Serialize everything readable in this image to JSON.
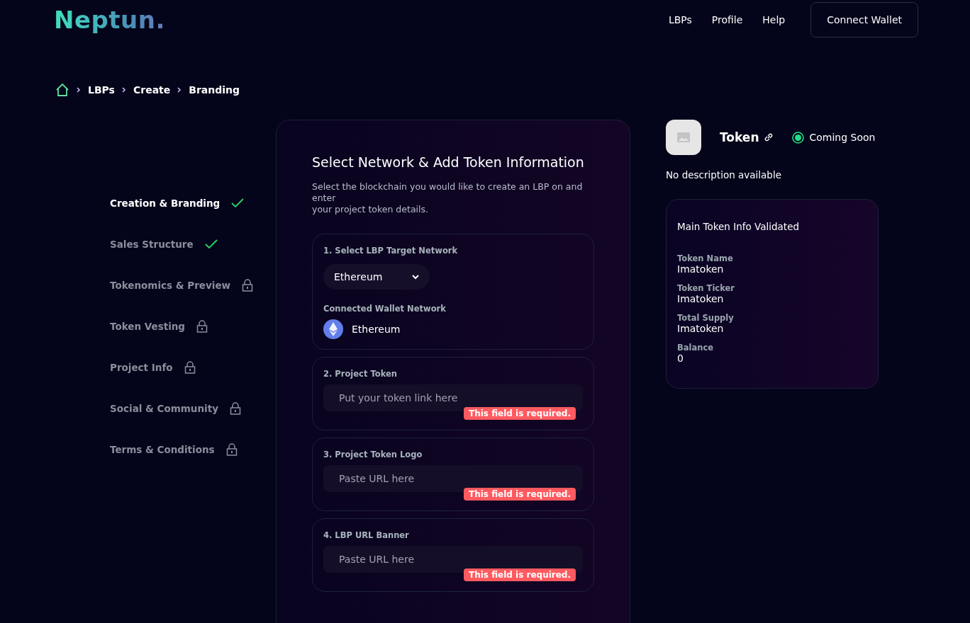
{
  "header": {
    "logo": "Neptun.",
    "nav": [
      "LBPs",
      "Profile",
      "Help"
    ],
    "connect_button": "Connect Wallet"
  },
  "breadcrumb": [
    "LBPs",
    "Create",
    "Branding"
  ],
  "steps": [
    {
      "label": "Creation & Branding",
      "selected": true,
      "kind": "done"
    },
    {
      "label": "Sales Structure",
      "selected": false,
      "kind": "done"
    },
    {
      "label": "Tokenomics & Preview",
      "selected": false,
      "kind": "locked"
    },
    {
      "label": "Token Vesting",
      "selected": false,
      "kind": "locked"
    },
    {
      "label": "Project Info",
      "selected": false,
      "kind": "locked"
    },
    {
      "label": "Social & Community",
      "selected": false,
      "kind": "locked"
    },
    {
      "label": "Terms & Conditions",
      "selected": false,
      "kind": "locked"
    }
  ],
  "form": {
    "title": "Select Network & Add Token Information",
    "description": "Select the blockchain you would like to create an LBP on and enter\nyour project token details.",
    "sections": [
      {
        "kind": "select",
        "label": "1. Select LBP Target Network",
        "value": "Ethereum",
        "wallet_label": "Connected Wallet Network",
        "wallet_network": "Ethereum"
      },
      {
        "kind": "input",
        "label": "2. Project Token",
        "placeholder": "Put your token link here",
        "error": "This field is required."
      },
      {
        "kind": "input",
        "label": "3. Project Token Logo",
        "placeholder": "Paste URL here",
        "error": "This field is required."
      },
      {
        "kind": "input",
        "label": "4. LBP URL Banner",
        "placeholder": "Paste URL here",
        "error": "This field is required."
      }
    ]
  },
  "preview": {
    "name": "Token",
    "status": "Coming Soon",
    "description": "No description available",
    "card_title": "Main Token Info Validated",
    "fields": [
      {
        "label": "Token Name",
        "value": "Imatoken"
      },
      {
        "label": "Token Ticker",
        "value": "Imatoken"
      },
      {
        "label": "Total Supply",
        "value": "Imatoken"
      },
      {
        "label": "Balance",
        "value": "0"
      }
    ]
  }
}
